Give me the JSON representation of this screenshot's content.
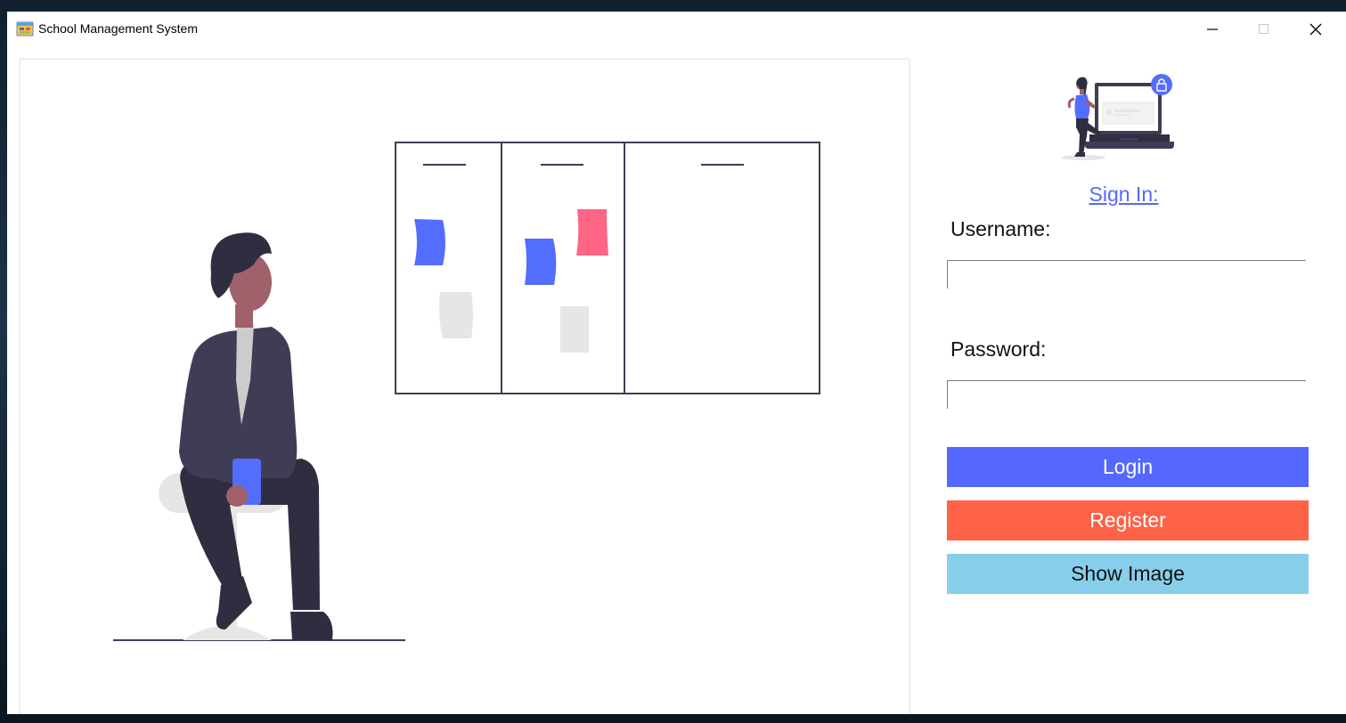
{
  "window": {
    "title": "School Management System"
  },
  "login": {
    "heading": "Sign In: ",
    "username_label": "Username:",
    "username_value": "",
    "password_label": "Password:",
    "password_value": "",
    "login_button": "Login",
    "register_button": "Register",
    "show_image_button": "Show Image"
  },
  "colors": {
    "login": "#5468ff",
    "register": "#ff6347",
    "show_image": "#87ceeb",
    "link": "#5468ff",
    "sticky_blue": "#536dfe",
    "sticky_pink": "#ff6584",
    "dark": "#3f3d56"
  },
  "icons": [
    "app-icon",
    "minimize-icon",
    "maximize-icon",
    "close-icon"
  ]
}
